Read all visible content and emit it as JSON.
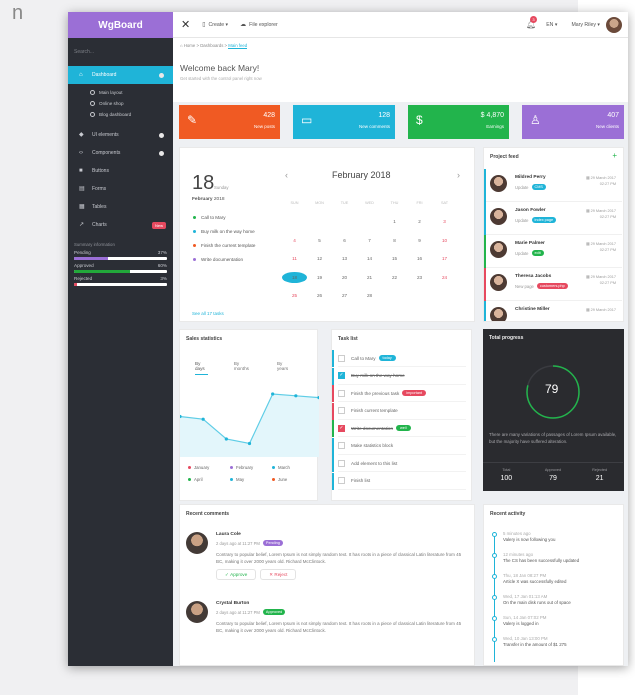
{
  "stub_text": "n",
  "sidebar": {
    "brand": "WgBoard",
    "search_placeholder": "Search...",
    "items": [
      {
        "label": "Dashboard",
        "icon": "home-icon"
      },
      {
        "label": "UI elements",
        "icon": "layers-icon"
      },
      {
        "label": "Components",
        "icon": "code-icon"
      },
      {
        "label": "Buttons",
        "icon": "square-icon"
      },
      {
        "label": "Forms",
        "icon": "form-icon"
      },
      {
        "label": "Tables",
        "icon": "table-icon"
      },
      {
        "label": "Charts",
        "icon": "chart-icon",
        "badge": "New"
      }
    ],
    "subitems": [
      "Main layout",
      "Online shop",
      "Blog dashboard"
    ],
    "summary_title": "Summary information",
    "progress": [
      {
        "label": "Pending",
        "value": "37%",
        "fraction": 0.37,
        "color": "#9b6fd6"
      },
      {
        "label": "Approved",
        "value": "60%",
        "fraction": 0.6,
        "color": "#22a83a"
      },
      {
        "label": "Rejected",
        "value": "3%",
        "fraction": 0.03,
        "color": "#e6495f"
      }
    ]
  },
  "topbar": {
    "create": "Create",
    "file_explorer": "File explorer",
    "notif_count": "3",
    "lang": "EN",
    "user": "Mary Riley"
  },
  "header": {
    "crumbs": [
      "Home",
      "Dashboards",
      "Main feed"
    ],
    "welcome": "Welcome back Mary!",
    "subtitle": "Get started with the control panel right now"
  },
  "stats": [
    {
      "value": "428",
      "label": "New posts",
      "color": "#f05a23",
      "icon": "pencil-icon"
    },
    {
      "value": "128",
      "label": "New comments",
      "color": "#1fb4d8",
      "icon": "comment-icon"
    },
    {
      "value": "$ 4,870",
      "label": "Earnings",
      "color": "#22b44c",
      "icon": "dollar-icon"
    },
    {
      "value": "407",
      "label": "New clients",
      "color": "#9b6fd6",
      "icon": "user-icon"
    }
  ],
  "calendar": {
    "day": "18",
    "dow": "Sunday",
    "month_bold": "February",
    "year": "2018",
    "title": "February 2018",
    "events": [
      {
        "text": "Call to Mary",
        "color": "#22b44c"
      },
      {
        "text": "Buy milk on the way home",
        "color": "#1fb4d8"
      },
      {
        "text": "Finish the current template",
        "color": "#f05a23"
      },
      {
        "text": "Write documentation",
        "color": "#9b6fd6"
      }
    ],
    "see_all": "See all 17 tasks",
    "weekdays": [
      "SUN",
      "MON",
      "TUE",
      "WED",
      "THU",
      "FRI",
      "SAT"
    ],
    "weeks": [
      [
        "",
        "",
        "",
        "",
        "1",
        "2",
        "3"
      ],
      [
        "4",
        "5",
        "6",
        "7",
        "8",
        "9",
        "10"
      ],
      [
        "11",
        "12",
        "13",
        "14",
        "15",
        "16",
        "17"
      ],
      [
        "18",
        "19",
        "20",
        "21",
        "22",
        "23",
        "24"
      ],
      [
        "25",
        "26",
        "27",
        "28",
        "",
        "",
        ""
      ]
    ]
  },
  "feed": {
    "title": "Project feed",
    "add": "+",
    "items": [
      {
        "name": "Mildred Perry",
        "type": "Update",
        "tag": "CMS",
        "tag_color": "#1fb4d8",
        "date": "29 March 2017",
        "time": "02:27 PM",
        "bar": "#1fb4d8"
      },
      {
        "name": "Jason Fowler",
        "type": "Update",
        "tag": "index page",
        "tag_color": "#1fb4d8",
        "date": "29 March 2017",
        "time": "02:27 PM",
        "bar": "#1fb4d8"
      },
      {
        "name": "Marie Palmer",
        "type": "Update",
        "tag": "edit",
        "tag_color": "#22b44c",
        "date": "29 March 2017",
        "time": "02:27 PM",
        "bar": "#22b44c"
      },
      {
        "name": "Theresa Jacobs",
        "type": "New page",
        "tag": "customers.php",
        "tag_color": "#e6495f",
        "date": "29 March 2017",
        "time": "02:27 PM",
        "bar": "#e6495f"
      },
      {
        "name": "Christine Miller",
        "type": "",
        "tag": "",
        "tag_color": "#1fb4d8",
        "date": "29 March 2017",
        "time": "",
        "bar": "#1fb4d8"
      }
    ]
  },
  "sales": {
    "title": "Sales statistics",
    "tabs": [
      "By days",
      "By months",
      "By years"
    ],
    "legend": [
      {
        "label": "January",
        "color": "#e6495f"
      },
      {
        "label": "February",
        "color": "#9b6fd6"
      },
      {
        "label": "March",
        "color": "#1fb4d8"
      },
      {
        "label": "April",
        "color": "#22b44c"
      },
      {
        "label": "May",
        "color": "#1fb4d8"
      },
      {
        "label": "June",
        "color": "#f05a23"
      }
    ],
    "series": [
      45,
      42,
      20,
      15,
      70,
      68,
      66
    ]
  },
  "tasks": {
    "title": "Task list",
    "items": [
      {
        "text": "Call to Mary",
        "done": false,
        "tag": "today",
        "tag_color": "#1fb4d8",
        "bar": "#1fb4d8"
      },
      {
        "text": "Buy milk on the way home",
        "done": true,
        "tag": "",
        "tag_color": "",
        "bar": "#1fb4d8",
        "cb_color": "#1fb4d8"
      },
      {
        "text": "Finish the previous task",
        "done": false,
        "tag": "important",
        "tag_color": "#e6495f",
        "bar": "#e6495f"
      },
      {
        "text": "Finish current template",
        "done": false,
        "tag": "",
        "tag_color": "",
        "bar": "#e6495f"
      },
      {
        "text": "Write documentation",
        "done": true,
        "tag": "well",
        "tag_color": "#22b44c",
        "bar": "#22b44c",
        "cb_color": "#e6495f"
      },
      {
        "text": "Make statistics block",
        "done": false,
        "tag": "",
        "tag_color": "",
        "bar": "#1fb4d8"
      },
      {
        "text": "Add element to this list",
        "done": false,
        "tag": "",
        "tag_color": "",
        "bar": "#1fb4d8"
      },
      {
        "text": "Finish list",
        "done": false,
        "tag": "",
        "tag_color": "",
        "bar": "#1fb4d8"
      }
    ]
  },
  "total_progress": {
    "title": "Total progress",
    "value": "79",
    "fraction": 0.79,
    "desc": "There are many variations of passages of Lorem Ipsum available, but the majority have suffered alteration.",
    "stats": [
      {
        "label": "Total",
        "value": "100"
      },
      {
        "label": "Approved",
        "value": "79"
      },
      {
        "label": "Rejected",
        "value": "21"
      }
    ]
  },
  "comments": {
    "title": "Recent comments",
    "items": [
      {
        "name": "Laura Cole",
        "meta": "2 days ago at 11:27 PM",
        "status": "Pending",
        "status_color": "#9b6fd6",
        "text": "Contrary to popular belief, Lorem Ipsum is not simply random text. It has roots in a piece of classical Latin literature from 45 BC, making it over 2000 years old. Richard McClintock.",
        "approve": "Approve",
        "reject": "Reject"
      },
      {
        "name": "Crystal Burton",
        "meta": "2 days ago at 11:27 PM",
        "status": "Approved",
        "status_color": "#22b44c",
        "text": "Contrary to popular belief, Lorem Ipsum is not simply random text. It has roots in a piece of classical Latin literature from 45 BC, making it over 2000 years old. Richard McClintock."
      }
    ]
  },
  "activity": {
    "title": "Recent activity",
    "items": [
      {
        "time": "5 minutes ago",
        "text": "Valery is now following you"
      },
      {
        "time": "12 minutes ago",
        "text": "The CS has been successfully updated"
      },
      {
        "time": "Thu, 18 Jan 08:27 PM",
        "text": "Article X was successfully edited"
      },
      {
        "time": "Wed, 17 Jan 01:13 AM",
        "text": "On the main disk runs out of space"
      },
      {
        "time": "Sun, 14 Jan 07:02 PM",
        "text": "Valery is logged in"
      },
      {
        "time": "Wed, 10 Jan 13:00 PM",
        "text": "Transfer in the amount of $1 275"
      }
    ]
  }
}
